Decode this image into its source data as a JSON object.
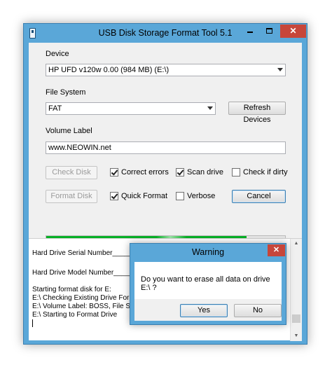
{
  "window": {
    "title": "USB Disk Storage Format Tool 5.1",
    "minimize_symbol": "",
    "close_symbol": "✕"
  },
  "device": {
    "label": "Device",
    "selected": "HP UFD  v120w  0.00 (984 MB) (E:\\)"
  },
  "file_system": {
    "label": "File System",
    "selected": "FAT",
    "refresh_label": "Refresh Devices"
  },
  "volume": {
    "label": "Volume Label",
    "value": "www.NEOWIN.net"
  },
  "buttons": {
    "check_disk": "Check Disk",
    "format_disk": "Format Disk",
    "cancel": "Cancel"
  },
  "options": {
    "correct_errors": {
      "label": "Correct errors",
      "checked": true
    },
    "scan_drive": {
      "label": "Scan drive",
      "checked": true
    },
    "check_if_dirty": {
      "label": "Check if dirty",
      "checked": false
    },
    "quick_format": {
      "label": "Quick Format",
      "checked": true
    },
    "verbose": {
      "label": "Verbose",
      "checked": false
    }
  },
  "progress": {
    "fraction": 0.84
  },
  "log": {
    "serial": "Hard Drive Serial Number______________",
    "model": "Hard Drive Model Number______________",
    "lines": [
      "Starting format disk for E:",
      "E:\\ Checking Existing Drive Format",
      "E:\\ Volume Label: BOSS, File System",
      "E:\\ Starting to Format Drive"
    ]
  },
  "dialog": {
    "title": "Warning",
    "message": "Do you want to erase all data on drive E:\\ ?",
    "yes": "Yes",
    "no": "No",
    "close_symbol": "✕"
  },
  "colors": {
    "title_bar": "#5aa7d8",
    "close_button": "#c7463a",
    "progress_green": "#06b025"
  }
}
